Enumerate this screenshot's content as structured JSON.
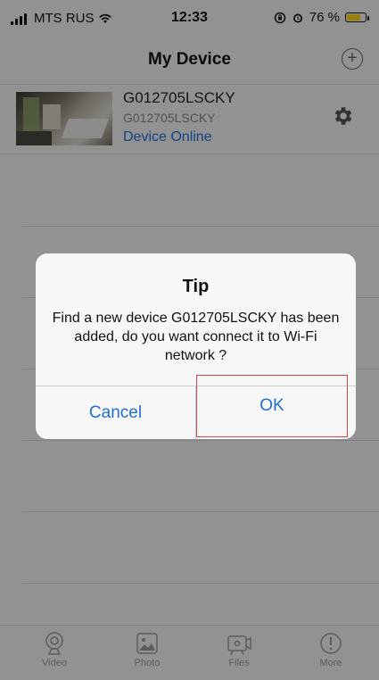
{
  "status_bar": {
    "carrier": "MTS RUS",
    "time": "12:33",
    "battery_percent": "76 %",
    "battery_level": 0.76,
    "battery_color": "#ffd60a"
  },
  "nav": {
    "title": "My Device",
    "add_icon": "plus-circle-icon"
  },
  "device": {
    "name": "G012705LSCKY",
    "subtitle": "G012705LSCKY",
    "status": "Device Online",
    "status_color": "#1f6fd6",
    "settings_icon": "gear-icon"
  },
  "dialog": {
    "title": "Tip",
    "message": "Find a new device G012705LSCKY has been added, do you want connect it to Wi-Fi network ?",
    "cancel_label": "Cancel",
    "ok_label": "OK",
    "button_color": "#1f6fd6",
    "highlight_color": "#d04a4a"
  },
  "tabs": [
    {
      "label": "Video",
      "icon": "camera-icon"
    },
    {
      "label": "Photo",
      "icon": "photo-icon"
    },
    {
      "label": "Files",
      "icon": "film-icon"
    },
    {
      "label": "More",
      "icon": "info-icon"
    }
  ]
}
